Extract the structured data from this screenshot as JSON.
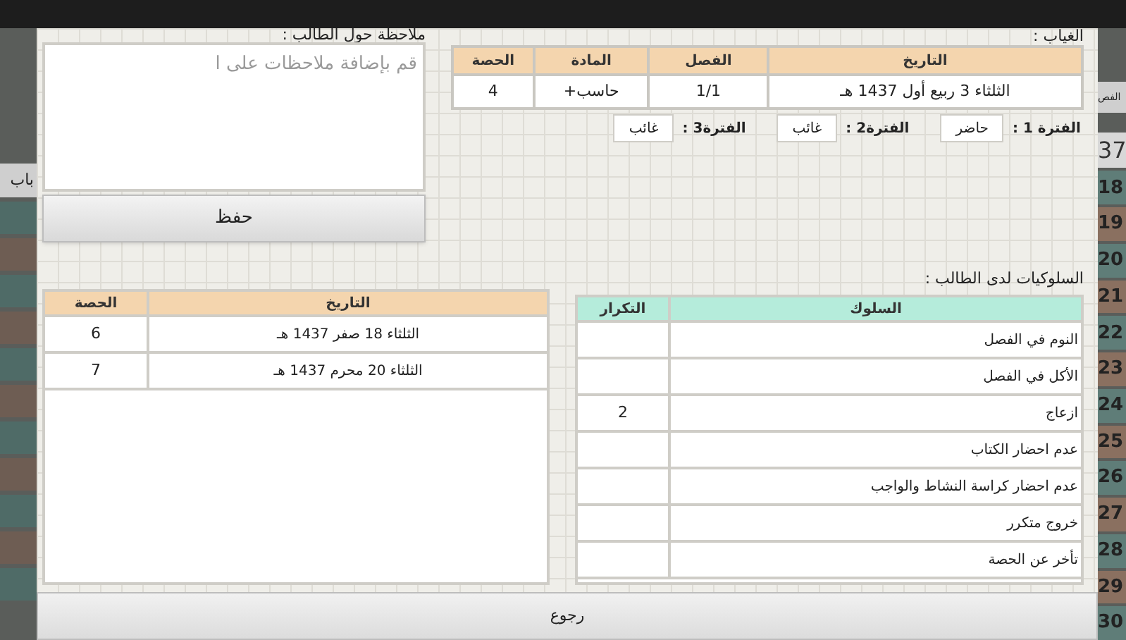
{
  "background": {
    "header_number": "37",
    "column_cut": "الفص",
    "left_cut": "باب",
    "row_numbers": [
      "18",
      "19",
      "20",
      "21",
      "22",
      "23",
      "24",
      "25",
      "26",
      "27",
      "28",
      "29",
      "30"
    ]
  },
  "absence": {
    "label": "الغياب :",
    "columns": [
      "التاريخ",
      "الفصل",
      "المادة",
      "الحصة"
    ],
    "row": [
      "الثلثاء 3 ربيع أول 1437 هـ",
      "1/1",
      "حاسب+",
      "4"
    ],
    "periods": [
      {
        "label": "الفترة 1 :",
        "value": "حاضر"
      },
      {
        "label": "الفترة2 :",
        "value": "غائب"
      },
      {
        "label": "الفترة3 :",
        "value": "غائب"
      }
    ]
  },
  "note": {
    "label": "ملاحظة حول الطالب :",
    "placeholder": "قم بإضافة ملاحظات على ا",
    "save_button": "حفظ"
  },
  "behaviors": {
    "label": "السلوكيات لدى الطالب :",
    "columns": [
      "السلوك",
      "التكرار"
    ],
    "rows": [
      {
        "behavior": "النوم في الفصل"
      },
      {
        "behavior": "الأكل في الفصل"
      },
      {
        "behavior": "ازعاج",
        "count": "2"
      },
      {
        "behavior": "عدم احضار الكتاب"
      },
      {
        "behavior": "عدم احضار كراسة النشاط والواجب"
      },
      {
        "behavior": "خروج متكرر"
      },
      {
        "behavior": "تأخر عن الحصة"
      }
    ]
  },
  "history": {
    "columns": [
      "التاريخ",
      "الحصة"
    ],
    "rows": [
      {
        "date": "الثلثاء 18 صفر 1437 هـ",
        "period": "6"
      },
      {
        "date": "الثلثاء 20 محرم 1437 هـ",
        "period": "7"
      }
    ]
  },
  "back_button": "رجوع"
}
